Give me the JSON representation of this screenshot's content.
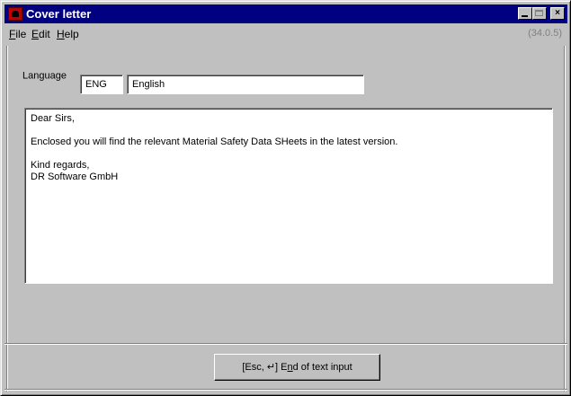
{
  "window": {
    "title": "Cover letter",
    "controls": {
      "minimize": "minimize",
      "maximize": "maximize",
      "close": "×"
    }
  },
  "menu": {
    "items": [
      {
        "label_ul": "F",
        "label_rest": "ile"
      },
      {
        "label_ul": "E",
        "label_rest": "dit"
      },
      {
        "label_ul": "H",
        "label_rest": "elp"
      }
    ],
    "version": "(34.0.5)"
  },
  "language": {
    "label": "Language",
    "code": "ENG",
    "name": "English"
  },
  "letter": {
    "lines": [
      "Dear Sirs,",
      "",
      "Enclosed you will find the relevant Material Safety Data SHeets in the latest version.",
      "",
      "Kind regards,",
      "DR Software GmbH"
    ]
  },
  "footer": {
    "button_prefix": "[Esc, ↵] E",
    "button_ul": "n",
    "button_suffix": "d of text input"
  },
  "colors": {
    "titlebar": "#000080",
    "face": "#c0c0c0",
    "version_text": "#808080"
  }
}
